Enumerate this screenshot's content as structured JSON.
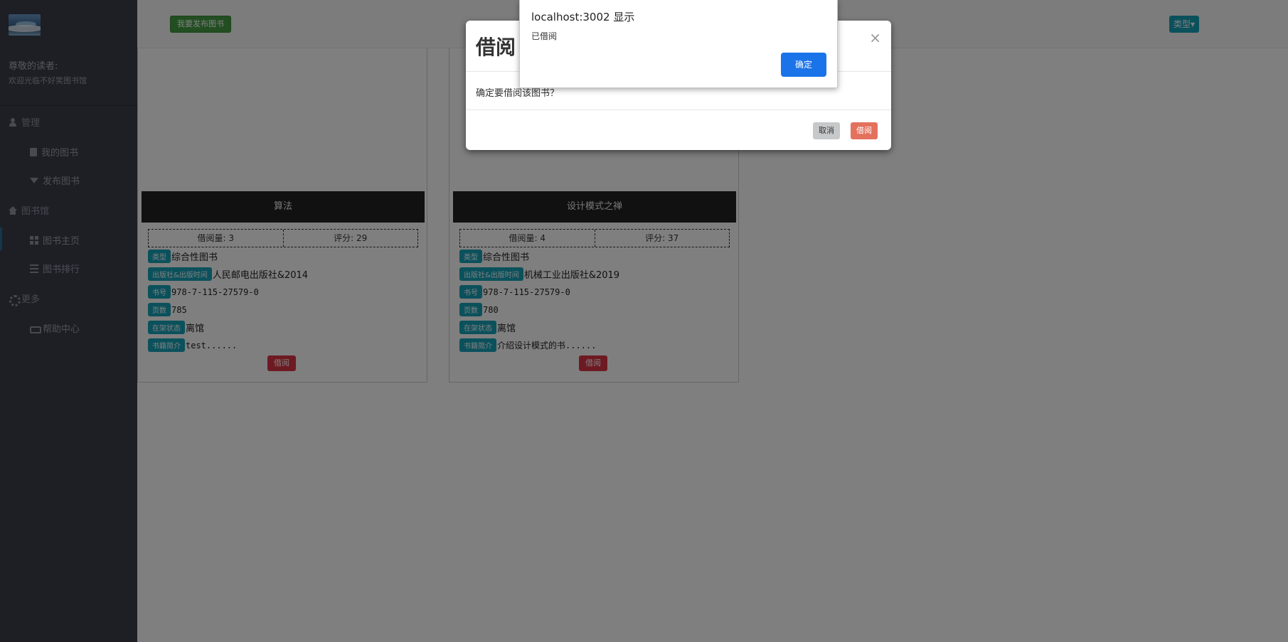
{
  "sidebar": {
    "greeting": "尊敬的读者:",
    "welcome": "欢迎光临不好笑图书馆",
    "groups": [
      {
        "label": "管理",
        "icon": "user-icon",
        "items": [
          {
            "label": "我的图书",
            "icon": "book-icon"
          },
          {
            "label": "发布图书",
            "icon": "filter-icon"
          }
        ]
      },
      {
        "label": "图书馆",
        "icon": "home-icon",
        "items": [
          {
            "label": "图书主页",
            "icon": "grid-icon"
          },
          {
            "label": "图书排行",
            "icon": "list-icon"
          }
        ]
      },
      {
        "label": "更多",
        "icon": "gear-icon",
        "items": [
          {
            "label": "帮助中心",
            "icon": "hand-icon"
          }
        ]
      }
    ]
  },
  "topbar": {
    "publish_label": "我要发布图书",
    "type_label": "类型▾"
  },
  "books": [
    {
      "title": "算法",
      "borrow_count": "借阅量: 3",
      "rating": "评分: 29",
      "type_badge": "类型",
      "type_value": "综合性图书",
      "publisher_badge": "出版社&出版时间",
      "publisher_value": "人民邮电出版社&2014",
      "isbn_badge": "书号",
      "isbn_value": "978-7-115-27579-0",
      "pages_badge": "页数",
      "pages_value": "785",
      "status_badge": "在架状态",
      "status_value": "离馆",
      "intro_badge": "书籍简介",
      "intro_value": "test......",
      "borrow_label": "借阅"
    },
    {
      "title": "设计模式之禅",
      "borrow_count": "借阅量: 4",
      "rating": "评分: 37",
      "type_badge": "类型",
      "type_value": "综合性图书",
      "publisher_badge": "出版社&出版时间",
      "publisher_value": "机械工业出版社&2019",
      "isbn_badge": "书号",
      "isbn_value": "978-7-115-27579-0",
      "pages_badge": "页数",
      "pages_value": "780",
      "status_badge": "在架状态",
      "status_value": "离馆",
      "intro_badge": "书籍简介",
      "intro_value": "介绍设计模式的书......",
      "borrow_label": "借阅"
    }
  ],
  "modal": {
    "title": "借阅",
    "close": "×",
    "body": "确定要借阅该图书？",
    "cancel_label": "取消",
    "borrow_label": "借阅"
  },
  "alert": {
    "title": "localhost:3002 显示",
    "message": "已借阅",
    "ok_label": "确定"
  },
  "colors": {
    "sidebar_bg": "#3a3f4a",
    "badge": "#17a2b8",
    "danger": "#dc3545",
    "success": "#449d44",
    "alert_ok": "#1a73e8"
  }
}
